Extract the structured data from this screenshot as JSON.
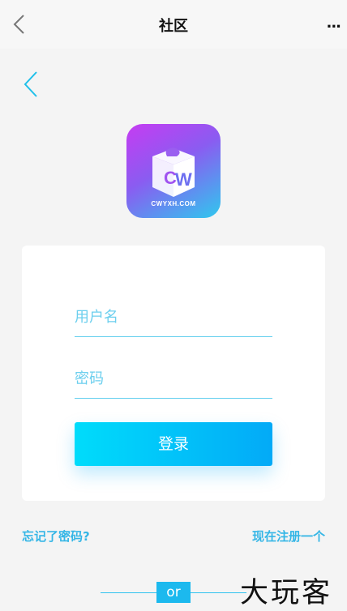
{
  "topbar": {
    "title": "社区",
    "back_icon": "chevron-left-icon",
    "more_label": "..."
  },
  "page": {
    "back_icon": "chevron-left-icon"
  },
  "logo": {
    "text": "CWYXH.COM",
    "colors": [
      "#c63cf2",
      "#8a5cf1",
      "#2fc8ee"
    ]
  },
  "form": {
    "username_placeholder": "用户名",
    "password_placeholder": "密码",
    "login_label": "登录"
  },
  "links": {
    "forgot_label": "忘记了密码?",
    "register_label": "现在注册一个"
  },
  "divider": {
    "label": "or"
  },
  "watermark": {
    "text": "大玩客"
  },
  "colors": {
    "accent": "#1cb9ee",
    "link": "#35b6e6"
  }
}
